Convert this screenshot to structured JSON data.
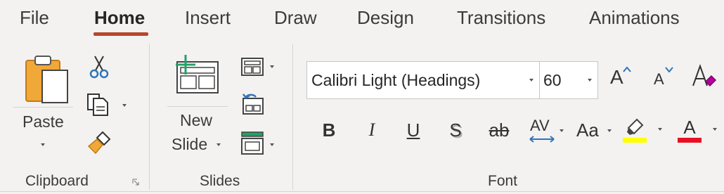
{
  "tabs": [
    {
      "label": "File"
    },
    {
      "label": "Home"
    },
    {
      "label": "Insert"
    },
    {
      "label": "Draw"
    },
    {
      "label": "Design"
    },
    {
      "label": "Transitions"
    },
    {
      "label": "Animations"
    }
  ],
  "active_tab": "Home",
  "clipboard": {
    "paste_label": "Paste",
    "group_label": "Clipboard"
  },
  "slides": {
    "new_slide_line1": "New",
    "new_slide_line2": "Slide",
    "group_label": "Slides"
  },
  "font": {
    "font_name": "Calibri Light (Headings)",
    "font_size": "60",
    "grow_label": "A",
    "shrink_label": "A",
    "bold": "B",
    "italic": "I",
    "underline": "U",
    "shadow": "S",
    "strike": "ab",
    "spacing": "AV",
    "change_case": "Aa",
    "font_color_letter": "A",
    "highlight_color": "#ffff00",
    "font_color": "#e81123",
    "group_label": "Font"
  },
  "colors": {
    "accent": "#b7472a",
    "ribbon_bg": "#f3f2f1",
    "paste_orange": "#f0a838",
    "icon_blue": "#2e75b6",
    "icon_green": "#21a366"
  }
}
